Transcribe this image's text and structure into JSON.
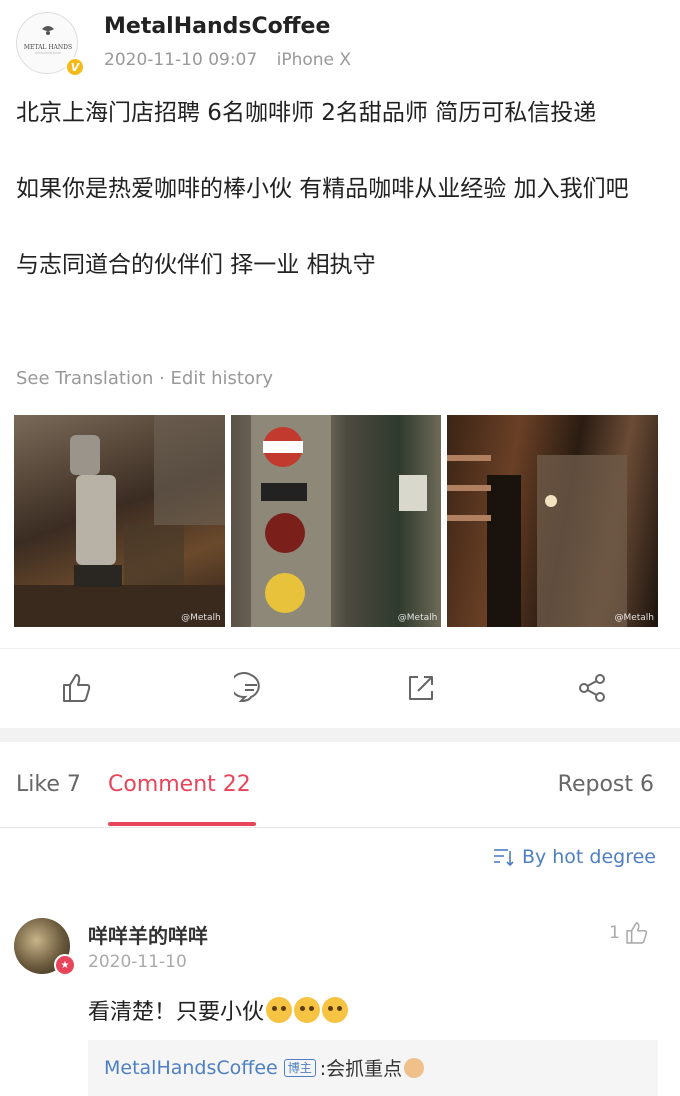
{
  "post": {
    "username": "MetalHandsCoffee",
    "avatar_text": "METAL HANDS",
    "verified_mark": "V",
    "timestamp": "2020-11-10 09:07",
    "device": "iPhone X",
    "paragraphs": [
      "北京上海门店招聘 6名咖啡师 2名甜品师 简历可私信投递",
      "如果你是热爱咖啡的棒小伙 有精品咖啡从业经验 加入我们吧",
      "与志同道合的伙伴们 择一业 相执守"
    ],
    "see_translation": "See Translation",
    "separator": " · ",
    "edit_history": "Edit history",
    "photos": [
      {
        "icon": "coffee-grinder-photo",
        "watermark": "@Metalh"
      },
      {
        "icon": "signs-wall-photo",
        "watermark": "@Metalh"
      },
      {
        "icon": "cafe-interior-photo",
        "watermark": "@Metalh"
      }
    ]
  },
  "actions": {
    "icons": [
      "like-icon",
      "comment-icon",
      "repost-icon",
      "share-icon"
    ]
  },
  "tabs": {
    "like": "Like 7",
    "comment": "Comment 22",
    "repost": "Repost 6"
  },
  "colors": {
    "accent": "#e8455a",
    "link": "#4e7fc4",
    "verified": "#f5b919"
  },
  "sort": {
    "label": "By hot degree",
    "icon": "sort-icon"
  },
  "comments": [
    {
      "name": "咩咩羊的咩咩",
      "date": "2020-11-10",
      "likes": "1",
      "text": "看清楚！只要小伙",
      "emoji_count": 3,
      "reply": {
        "author": "MetalHandsCoffee",
        "tag": "博主",
        "text": ":会抓重点"
      }
    }
  ]
}
